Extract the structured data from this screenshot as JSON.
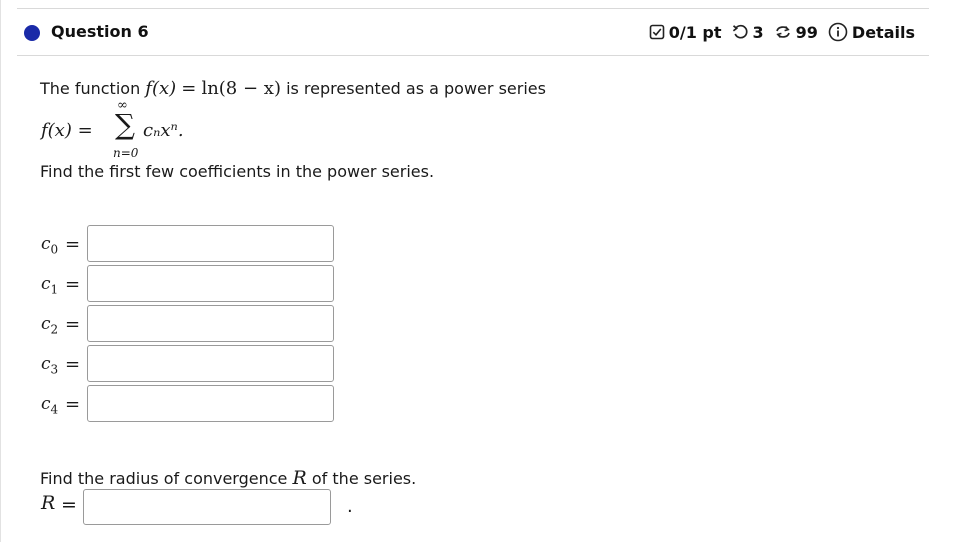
{
  "header": {
    "question_title": "Question 6",
    "score": "0/1 pt",
    "retries": "3",
    "attempts": "99",
    "details_label": "Details",
    "icons": {
      "score": "checkbox-icon",
      "retries": "undo-icon",
      "attempts": "sync-icon",
      "details": "info-icon"
    }
  },
  "problem": {
    "intro_prefix": "The function",
    "intro_suffix": "is represented as a power series",
    "function_lhs": "f(x)",
    "function_eq": "=",
    "function_rhs": "ln(8 − x)",
    "series_lhs": "f(x) =",
    "sum_upper": "∞",
    "sum_symbol": "∑",
    "sum_lower": "n=0",
    "series_term": "cₙxⁿ.",
    "prompt": "Find the first few coefficients in the power series."
  },
  "coefficients": [
    {
      "base": "c",
      "sub": "0",
      "eq": "=",
      "value": ""
    },
    {
      "base": "c",
      "sub": "1",
      "eq": "=",
      "value": ""
    },
    {
      "base": "c",
      "sub": "2",
      "eq": "=",
      "value": ""
    },
    {
      "base": "c",
      "sub": "3",
      "eq": "=",
      "value": ""
    },
    {
      "base": "c",
      "sub": "4",
      "eq": "=",
      "value": ""
    }
  ],
  "radius": {
    "prompt_prefix": "Find the radius of convergence",
    "symbol": "R",
    "prompt_suffix": "of the series.",
    "label": "R",
    "eq": "=",
    "value": "",
    "period": "."
  },
  "colors": {
    "bullet": "#1a2aa8",
    "border": "#9a9a9a"
  }
}
